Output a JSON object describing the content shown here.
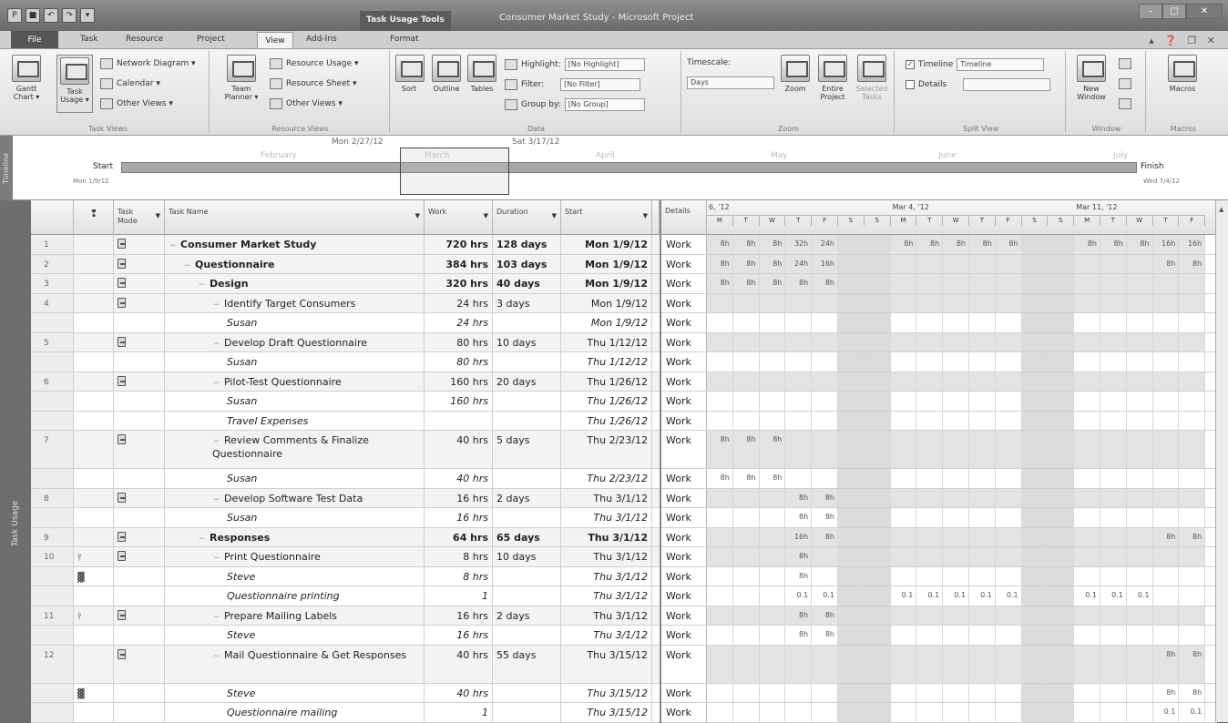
{
  "window": {
    "title": "Consumer Market Study - Microsoft Project",
    "context_tab": "Task Usage Tools"
  },
  "quick_access": [
    "P",
    "■",
    "↶",
    "↷",
    "▾"
  ],
  "window_buttons": {
    "min": "–",
    "max": "□",
    "close": "✕"
  },
  "help_icons": "▴ ❓ ❐ ✕",
  "tabs": {
    "file": "File",
    "task": "Task",
    "resource": "Resource",
    "project": "Project",
    "view": "View",
    "addins": "Add-Ins",
    "format": "Format"
  },
  "ribbon": {
    "task_views": {
      "label": "Task Views",
      "gantt": "Gantt\nChart ▾",
      "task_usage": "Task\nUsage ▾",
      "network": "Network Diagram ▾",
      "calendar": "Calendar ▾",
      "other": "Other Views ▾"
    },
    "resource_views": {
      "label": "Resource Views",
      "team": "Team\nPlanner ▾",
      "usage": "Resource Usage ▾",
      "sheet": "Resource Sheet ▾",
      "other": "Other Views ▾"
    },
    "data": {
      "label": "Data",
      "sort": "Sort",
      "outline": "Outline",
      "tables": "Tables",
      "highlight_label": "Highlight:",
      "highlight_value": "[No Highlight]",
      "filter_label": "Filter:",
      "filter_value": "[No Filter]",
      "group_label": "Group by:",
      "group_value": "[No Group]"
    },
    "zoom": {
      "label": "Zoom",
      "timescale_label": "Timescale:",
      "timescale_value": "Days",
      "zoom": "Zoom",
      "entire": "Entire\nProject",
      "selected": "Selected\nTasks"
    },
    "split_view": {
      "label": "Split View",
      "timeline_label": "Timeline",
      "timeline_value": "Timeline",
      "details_label": "Details"
    },
    "window": {
      "label": "Window",
      "new_window": "New\nWindow"
    },
    "macros": {
      "label": "Macros",
      "macros": "Macros"
    }
  },
  "timeline": {
    "side": "Timeline",
    "months": [
      "February",
      "March",
      "April",
      "May",
      "June",
      "July"
    ],
    "date_left": "Mon 2/27/12",
    "date_right": "Sat 3/17/12",
    "start": "Start",
    "start_date": "Mon 1/9/12",
    "finish": "Finish",
    "finish_date": "Wed 7/4/12"
  },
  "side_label": "Task Usage",
  "columns": {
    "mode": "Task\nMode",
    "name": "Task Name",
    "work": "Work",
    "duration": "Duration",
    "start": "Start",
    "details": "Details"
  },
  "weeks": [
    "6, '12",
    "Mar 4, '12",
    "Mar 11, '12"
  ],
  "days": [
    "M",
    "T",
    "W",
    "T",
    "F",
    "S",
    "S",
    "M",
    "T",
    "W",
    "T",
    "F",
    "S",
    "S",
    "M",
    "T",
    "W",
    "T",
    "F"
  ],
  "rows": [
    {
      "id": "1",
      "name": "Consumer Market Study",
      "work": "720 hrs",
      "dur": "128 days",
      "start": "Mon 1/9/12",
      "type": "summary",
      "level": 0,
      "detail": "Work",
      "cells": [
        "8h",
        "8h",
        "8h",
        "32h",
        "24h",
        "",
        "",
        "8h",
        "8h",
        "8h",
        "8h",
        "8h",
        "",
        "",
        "8h",
        "8h",
        "8h",
        "16h",
        "16h"
      ]
    },
    {
      "id": "2",
      "name": "Questionnaire",
      "work": "384 hrs",
      "dur": "103 days",
      "start": "Mon 1/9/12",
      "type": "summary",
      "level": 1,
      "detail": "Work",
      "cells": [
        "8h",
        "8h",
        "8h",
        "24h",
        "16h",
        "",
        "",
        "",
        "",
        "",
        "",
        "",
        "",
        "",
        "",
        "",
        "",
        "8h",
        "8h"
      ]
    },
    {
      "id": "3",
      "name": "Design",
      "work": "320 hrs",
      "dur": "40 days",
      "start": "Mon 1/9/12",
      "type": "summary",
      "level": 2,
      "detail": "Work",
      "cells": [
        "8h",
        "8h",
        "8h",
        "8h",
        "8h",
        "",
        "",
        "",
        "",
        "",
        "",
        "",
        "",
        "",
        "",
        "",
        "",
        "",
        ""
      ]
    },
    {
      "id": "4",
      "name": "Identify Target Consumers",
      "work": "24 hrs",
      "dur": "3 days",
      "start": "Mon 1/9/12",
      "type": "task",
      "level": 3,
      "detail": "Work",
      "cells": []
    },
    {
      "id": "",
      "name": "Susan",
      "work": "24 hrs",
      "dur": "",
      "start": "Mon 1/9/12",
      "type": "assign",
      "level": 4,
      "detail": "Work",
      "cells": []
    },
    {
      "id": "5",
      "name": "Develop Draft Questionnaire",
      "work": "80 hrs",
      "dur": "10 days",
      "start": "Thu 1/12/12",
      "type": "task",
      "level": 3,
      "detail": "Work",
      "cells": []
    },
    {
      "id": "",
      "name": "Susan",
      "work": "80 hrs",
      "dur": "",
      "start": "Thu 1/12/12",
      "type": "assign",
      "level": 4,
      "detail": "Work",
      "cells": []
    },
    {
      "id": "6",
      "name": "Pilot-Test Questionnaire",
      "work": "160 hrs",
      "dur": "20 days",
      "start": "Thu 1/26/12",
      "type": "task",
      "level": 3,
      "detail": "Work",
      "cells": []
    },
    {
      "id": "",
      "name": "Susan",
      "work": "160 hrs",
      "dur": "",
      "start": "Thu 1/26/12",
      "type": "assign",
      "level": 4,
      "detail": "Work",
      "cells": []
    },
    {
      "id": "",
      "name": "Travel Expenses",
      "work": "",
      "dur": "",
      "start": "Thu 1/26/12",
      "type": "assign",
      "level": 4,
      "detail": "Work",
      "cells": []
    },
    {
      "id": "7",
      "name": "Review Comments & Finalize Questionnaire",
      "work": "40 hrs",
      "dur": "5 days",
      "start": "Thu 2/23/12",
      "type": "task",
      "level": 3,
      "detail": "Work",
      "tall": true,
      "cells": [
        "8h",
        "8h",
        "8h",
        "",
        "",
        "",
        "",
        "",
        "",
        "",
        "",
        "",
        "",
        "",
        "",
        "",
        "",
        "",
        ""
      ]
    },
    {
      "id": "",
      "name": "Susan",
      "work": "40 hrs",
      "dur": "",
      "start": "Thu 2/23/12",
      "type": "assign",
      "level": 4,
      "detail": "Work",
      "cells": [
        "8h",
        "8h",
        "8h",
        "",
        "",
        "",
        "",
        "",
        "",
        "",
        "",
        "",
        "",
        "",
        "",
        "",
        "",
        "",
        ""
      ]
    },
    {
      "id": "8",
      "name": "Develop Software Test Data",
      "work": "16 hrs",
      "dur": "2 days",
      "start": "Thu 3/1/12",
      "type": "task",
      "level": 3,
      "detail": "Work",
      "cells": [
        "",
        "",
        "",
        "8h",
        "8h",
        "",
        "",
        "",
        "",
        "",
        "",
        "",
        "",
        "",
        "",
        "",
        "",
        "",
        ""
      ]
    },
    {
      "id": "",
      "name": "Susan",
      "work": "16 hrs",
      "dur": "",
      "start": "Thu 3/1/12",
      "type": "assign",
      "level": 4,
      "detail": "Work",
      "cells": [
        "",
        "",
        "",
        "8h",
        "8h",
        "",
        "",
        "",
        "",
        "",
        "",
        "",
        "",
        "",
        "",
        "",
        "",
        "",
        ""
      ]
    },
    {
      "id": "9",
      "name": "Responses",
      "work": "64 hrs",
      "dur": "65 days",
      "start": "Thu 3/1/12",
      "type": "summary",
      "level": 2,
      "detail": "Work",
      "cells": [
        "",
        "",
        "",
        "16h",
        "8h",
        "",
        "",
        "",
        "",
        "",
        "",
        "",
        "",
        "",
        "",
        "",
        "",
        "8h",
        "8h"
      ]
    },
    {
      "id": "10",
      "name": "Print Questionnaire",
      "work": "8 hrs",
      "dur": "10 days",
      "start": "Thu 3/1/12",
      "type": "task",
      "level": 3,
      "detail": "Work",
      "ind": "⫯",
      "cells": [
        "",
        "",
        "",
        "8h",
        "",
        "",
        "",
        "",
        "",
        "",
        "",
        "",
        "",
        "",
        "",
        "",
        "",
        "",
        ""
      ]
    },
    {
      "id": "",
      "name": "Steve",
      "work": "8 hrs",
      "dur": "",
      "start": "Thu 3/1/12",
      "type": "assign",
      "level": 4,
      "detail": "Work",
      "ind": "▓",
      "cells": [
        "",
        "",
        "",
        "8h",
        "",
        "",
        "",
        "",
        "",
        "",
        "",
        "",
        "",
        "",
        "",
        "",
        "",
        "",
        ""
      ]
    },
    {
      "id": "",
      "name": "Questionnaire printing",
      "work": "1",
      "dur": "",
      "start": "Thu 3/1/12",
      "type": "assign",
      "level": 4,
      "detail": "Work",
      "cells": [
        "",
        "",
        "",
        "0.1",
        "0.1",
        "",
        "",
        "0.1",
        "0.1",
        "0.1",
        "0.1",
        "0.1",
        "",
        "",
        "0.1",
        "0.1",
        "0.1",
        "",
        ""
      ]
    },
    {
      "id": "11",
      "name": "Prepare Mailing Labels",
      "work": "16 hrs",
      "dur": "2 days",
      "start": "Thu 3/1/12",
      "type": "task",
      "level": 3,
      "detail": "Work",
      "ind": "⫯",
      "cells": [
        "",
        "",
        "",
        "8h",
        "8h",
        "",
        "",
        "",
        "",
        "",
        "",
        "",
        "",
        "",
        "",
        "",
        "",
        "",
        ""
      ]
    },
    {
      "id": "",
      "name": "Steve",
      "work": "16 hrs",
      "dur": "",
      "start": "Thu 3/1/12",
      "type": "assign",
      "level": 4,
      "detail": "Work",
      "cells": [
        "",
        "",
        "",
        "8h",
        "8h",
        "",
        "",
        "",
        "",
        "",
        "",
        "",
        "",
        "",
        "",
        "",
        "",
        "",
        ""
      ]
    },
    {
      "id": "12",
      "name": "Mail Questionnaire & Get Responses",
      "work": "40 hrs",
      "dur": "55 days",
      "start": "Thu 3/15/12",
      "type": "task",
      "level": 3,
      "detail": "Work",
      "tall": true,
      "cells": [
        "",
        "",
        "",
        "",
        "",
        "",
        "",
        "",
        "",
        "",
        "",
        "",
        "",
        "",
        "",
        "",
        "",
        "8h",
        "8h"
      ]
    },
    {
      "id": "",
      "name": "Steve",
      "work": "40 hrs",
      "dur": "",
      "start": "Thu 3/15/12",
      "type": "assign",
      "level": 4,
      "detail": "Work",
      "ind": "▓",
      "cells": [
        "",
        "",
        "",
        "",
        "",
        "",
        "",
        "",
        "",
        "",
        "",
        "",
        "",
        "",
        "",
        "",
        "",
        "8h",
        "8h"
      ]
    },
    {
      "id": "",
      "name": "Questionnaire mailing",
      "work": "1",
      "dur": "",
      "start": "Thu 3/15/12",
      "type": "assign",
      "level": 4,
      "detail": "Work",
      "cells": [
        "",
        "",
        "",
        "",
        "",
        "",
        "",
        "",
        "",
        "",
        "",
        "",
        "",
        "",
        "",
        "",
        "",
        "0.1",
        "0.1"
      ]
    }
  ]
}
